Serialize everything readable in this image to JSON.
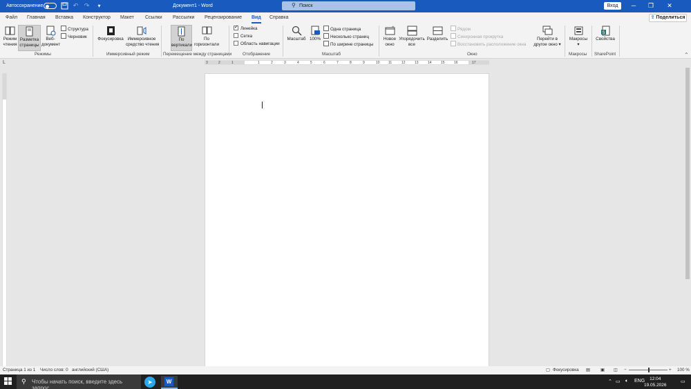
{
  "titlebar": {
    "autosave_label": "Автосохранение",
    "doc_title": "Документ1  -  Word",
    "search_placeholder": "Поиск",
    "signin_label": "Вход"
  },
  "menu": {
    "tabs": [
      "Файл",
      "Главная",
      "Вставка",
      "Конструктор",
      "Макет",
      "Ссылки",
      "Рассылки",
      "Рецензирование",
      "Вид",
      "Справка"
    ],
    "active_tab": "Вид",
    "share_label": "Поделиться"
  },
  "ribbon": {
    "views": {
      "read_mode": "Режим\nчтения",
      "print_layout": "Разметка\nстраницы",
      "web_layout": "Веб-\nдокумент",
      "outline": "Структура",
      "draft": "Черновик",
      "group_label": "Режимы"
    },
    "immersive": {
      "focus": "Фокусировка",
      "reader": "Иммерсивное\nсредство чтения",
      "group_label": "Иммерсивный режим"
    },
    "page_movement": {
      "vertical": "По\nвертикали",
      "side_to_side": "По\nгоризонтали",
      "group_label": "Перемещение между страницами"
    },
    "show": {
      "ruler": "Линейка",
      "gridlines": "Сетка",
      "nav_pane": "Область навигации",
      "group_label": "Отображение"
    },
    "zoom": {
      "zoom": "Масштаб",
      "hundred": "100%",
      "one_page": "Одна страница",
      "multiple_pages": "Несколько страниц",
      "page_width": "По ширине страницы",
      "group_label": "Масштаб"
    },
    "window": {
      "new_window": "Новое\nокно",
      "arrange_all": "Упорядочить\nвсе",
      "split": "Разделить",
      "side_by_side": "Рядом",
      "sync_scroll": "Синхронная прокрутка",
      "reset_position": "Восстановить расположение окна",
      "switch_windows": "Перейти в\nдругое окно ▾",
      "group_label": "Окно"
    },
    "macros": {
      "macros": "Макросы\n▾",
      "group_label": "Макросы"
    },
    "sharepoint": {
      "properties": "Свойства",
      "group_label": "SharePoint"
    }
  },
  "ruler": {
    "labels": [
      "3",
      "2",
      "1",
      "1",
      "2",
      "3",
      "4",
      "5",
      "6",
      "7",
      "8",
      "9",
      "10",
      "11",
      "12",
      "13",
      "14",
      "15",
      "16",
      "17"
    ]
  },
  "statusbar": {
    "page": "Страница 1 из 1",
    "words": "Число слов: 0",
    "language": "английский (США)",
    "focus": "Фокусировка",
    "zoom": "100 %",
    "zoom_fraction": 0.5
  },
  "taskbar": {
    "search_placeholder": "Чтобы начать поиск, введите здесь запрос",
    "language": "ENG",
    "time": "12:04",
    "date": "19.05.2026"
  },
  "colors": {
    "accent": "#185abd",
    "ribbon_bg": "#f3f3f3",
    "canvas_bg": "#e6e6e6",
    "taskbar_bg": "#202020"
  },
  "icons": [
    "save-icon",
    "undo-icon",
    "redo-icon",
    "customize-icon",
    "search-icon",
    "minimize-icon",
    "maximize-icon",
    "close-icon",
    "windows-start-icon",
    "telegram-icon",
    "word-icon"
  ]
}
